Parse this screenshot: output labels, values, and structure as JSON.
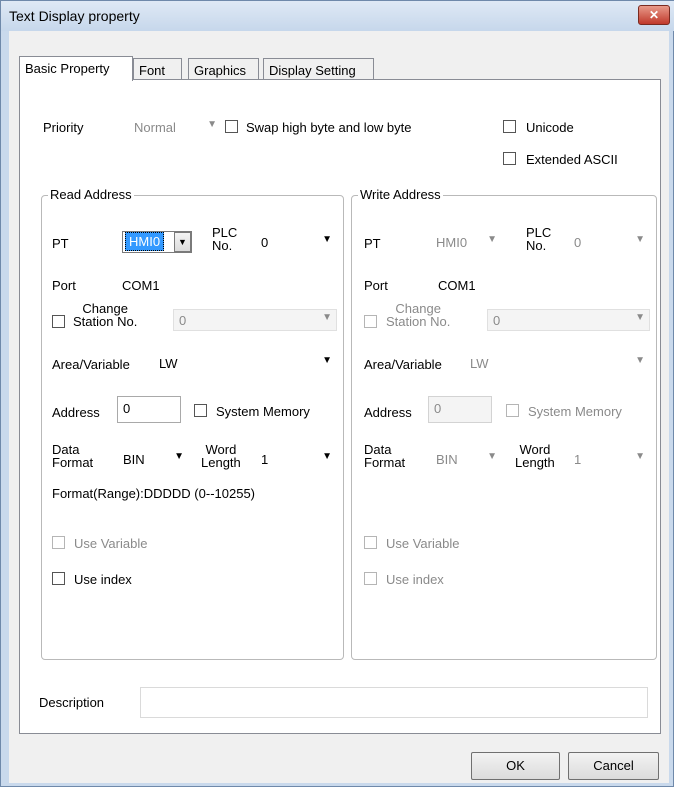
{
  "window": {
    "title": "Text Display property",
    "close_symbol": "✕"
  },
  "tabs": [
    {
      "label": "Basic Property"
    },
    {
      "label": "Font"
    },
    {
      "label": "Graphics"
    },
    {
      "label": "Display Setting"
    }
  ],
  "top": {
    "priority_label": "Priority",
    "priority_value": "Normal",
    "swap_label": "Swap high byte and low byte",
    "unicode_label": "Unicode",
    "extended_ascii_label": "Extended ASCII"
  },
  "read": {
    "title": "Read Address",
    "pt_label": "PT",
    "pt_value": "HMI0",
    "plc_label_1": "PLC",
    "plc_label_2": "No.",
    "plc_value": "0",
    "port_label": "Port",
    "port_value": "COM1",
    "change_label_1": "Change",
    "change_label_2": "Station No.",
    "change_value": "0",
    "area_label": "Area/Variable",
    "area_value": "LW",
    "address_label": "Address",
    "address_value": "0",
    "sysmem_label": "System Memory",
    "data_label_1": "Data",
    "data_label_2": "Format",
    "data_value": "BIN",
    "word_label_1": "Word",
    "word_label_2": "Length",
    "word_value": "1",
    "format_range": "Format(Range):DDDDD (0--10255)",
    "use_variable_label": "Use Variable",
    "use_index_label": "Use index"
  },
  "write": {
    "title": "Write Address",
    "pt_label": "PT",
    "pt_value": "HMI0",
    "plc_label_1": "PLC",
    "plc_label_2": "No.",
    "plc_value": "0",
    "port_label": "Port",
    "port_value": "COM1",
    "change_label_1": "Change",
    "change_label_2": "Station No.",
    "change_value": "0",
    "area_label": "Area/Variable",
    "area_value": "LW",
    "address_label": "Address",
    "address_value": "0",
    "sysmem_label": "System Memory",
    "data_label_1": "Data",
    "data_label_2": "Format",
    "data_value": "BIN",
    "word_label_1": "Word",
    "word_label_2": "Length",
    "word_value": "1",
    "use_variable_label": "Use Variable",
    "use_index_label": "Use index"
  },
  "description": {
    "label": "Description",
    "value": ""
  },
  "buttons": {
    "ok": "OK",
    "cancel": "Cancel"
  },
  "arrow_glyph": "▼"
}
